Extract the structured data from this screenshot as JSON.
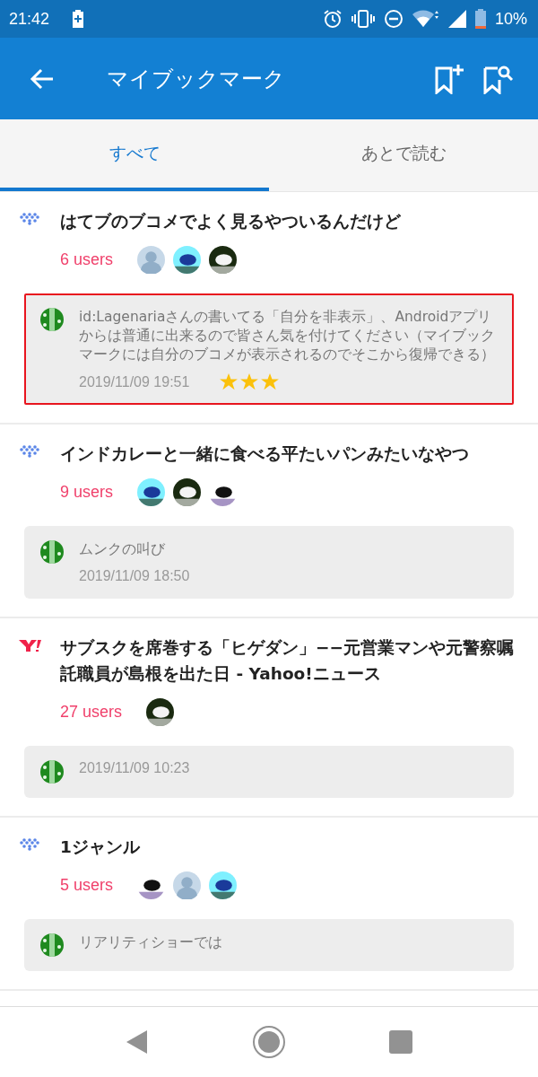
{
  "status_bar": {
    "time": "21:42",
    "battery": "10%"
  },
  "app_bar": {
    "title": "マイブックマーク"
  },
  "tabs": [
    {
      "label": "すべて",
      "selected": true
    },
    {
      "label": "あとで読む",
      "selected": false
    }
  ],
  "entries": [
    {
      "kind": "hatena",
      "title": "はてブのブコメでよく見るやついるんだけど",
      "users": "6 users",
      "avatars": [
        {
          "kind": "silhouette"
        },
        {
          "kind": "picture"
        },
        {
          "kind": "picture"
        }
      ],
      "comment": {
        "highlighted": true,
        "text": "id:Lagenariaさんの書いてる「自分を非表示」、Androidアプリからは普通に出来るので皆さん気を付けてください（マイブックマークには自分のブコメが表示されるのでそこから復帰できる）",
        "date": "2019/11/09 19:51",
        "stars": 3
      }
    },
    {
      "kind": "hatena",
      "title": "インドカレーと一緒に食べる平たいパンみたいなやつ",
      "users": "9 users",
      "avatars": [
        {
          "kind": "picture"
        },
        {
          "kind": "picture"
        },
        {
          "kind": "picture"
        }
      ],
      "comment": {
        "highlighted": false,
        "text": "ムンクの叫び",
        "date": "2019/11/09 18:50"
      }
    },
    {
      "kind": "yahoo",
      "title": "サブスクを席巻する「ヒゲダン」−−元営業マンや元警察嘱託職員が島根を出た日 - Yahoo!ニュース",
      "users": "27 users",
      "avatars": [
        {
          "kind": "picture"
        }
      ],
      "comment": {
        "highlighted": false,
        "date": "2019/11/09 10:23"
      }
    },
    {
      "kind": "hatena",
      "title": "1ジャンル",
      "users": "5 users",
      "avatars": [
        {
          "kind": "picture"
        },
        {
          "kind": "silhouette"
        },
        {
          "kind": "picture"
        }
      ],
      "comment": {
        "highlighted": false,
        "text": "リアリティショーでは"
      }
    }
  ]
}
